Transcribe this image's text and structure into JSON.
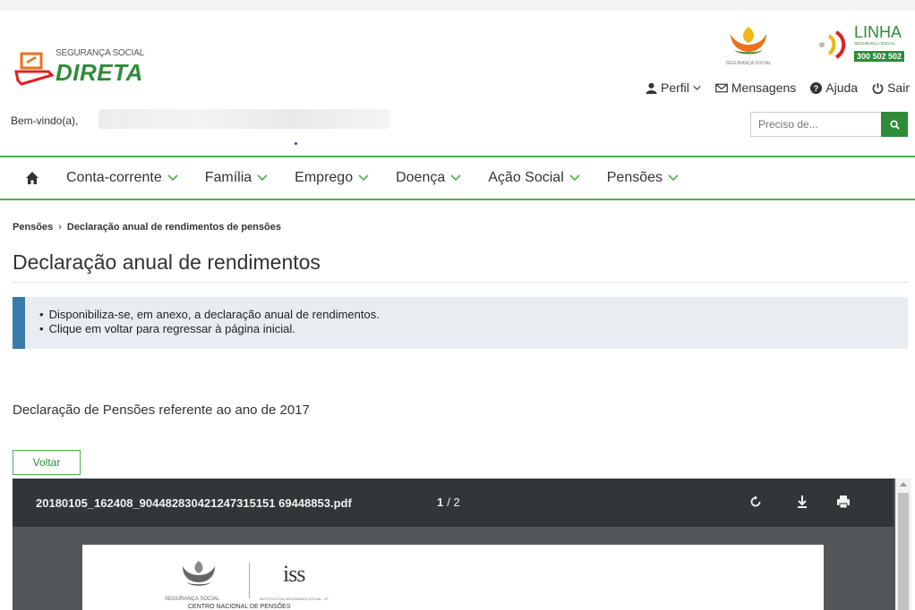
{
  "header": {
    "logo_small": "SEGURANÇA SOCIAL",
    "logo_big": "DIRETA",
    "emblem_label": "SEGURANÇA SOCIAL",
    "linha": {
      "title": "LINHA",
      "sub": "SEGURANÇA SOCIAL",
      "number": "300 502 502"
    },
    "user_nav": {
      "perfil": "Perfil",
      "mensagens": "Mensagens",
      "ajuda": "Ajuda",
      "sair": "Sair"
    },
    "welcome": "Bem-vindo(a),",
    "search": {
      "placeholder": "Preciso de..."
    }
  },
  "nav": {
    "items": [
      {
        "label": "Conta-corrente"
      },
      {
        "label": "Família"
      },
      {
        "label": "Emprego"
      },
      {
        "label": "Doença"
      },
      {
        "label": "Ação Social"
      },
      {
        "label": "Pensões"
      }
    ]
  },
  "breadcrumb": {
    "parent": "Pensões",
    "separator": "›",
    "current": "Declaração anual de rendimentos de pensões"
  },
  "page_title": "Declaração anual de rendimentos",
  "notice": {
    "items": [
      "Disponibiliza-se, em anexo, a declaração anual de rendimentos.",
      "Clique em voltar para regressar à página inicial."
    ]
  },
  "declaration_text": "Declaração de Pensões referente ao ano de 2017",
  "back_button": "Voltar",
  "pdf_viewer": {
    "filename": "20180105_162408_904482830421247315151 69448853.pdf",
    "current_page": "1",
    "total_pages": "/ 2",
    "doc": {
      "emblem_label": "SEGURANÇA SOCIAL",
      "iss": "iss",
      "iss_sub": "INSTITUTO DA SEGURANÇA SOCIAL, I.P.",
      "centro": "CENTRO NACIONAL DE PENSÕES"
    }
  },
  "colors": {
    "brand_green": "#2e8b3a",
    "nav_border": "#4caf50",
    "notice_accent": "#3a7bab",
    "notice_bg": "#e8edf1",
    "logo_orange": "#e8731c"
  }
}
